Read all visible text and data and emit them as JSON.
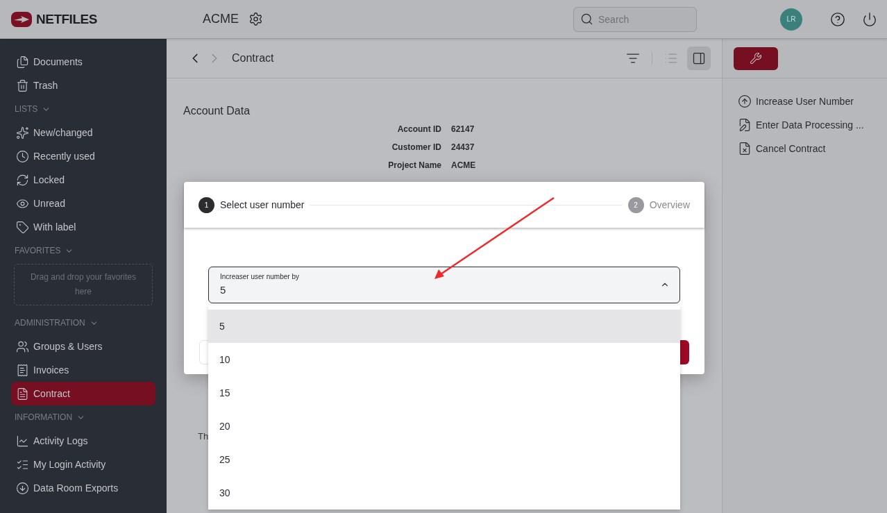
{
  "header": {
    "logo": "NETFILES",
    "project": "ACME",
    "search": {
      "placeholder": "Search"
    },
    "avatar": "LR"
  },
  "sidebar": {
    "sections": [
      {
        "items": [
          {
            "label": "Documents",
            "selected": false
          },
          {
            "label": "Trash",
            "selected": false
          }
        ]
      },
      {
        "title": "LISTS",
        "expanded": true,
        "items": [
          {
            "label": "New/changed",
            "selected": false
          },
          {
            "label": "Recently used",
            "selected": false
          },
          {
            "label": "Locked",
            "selected": false
          },
          {
            "label": "Unread",
            "selected": false
          },
          {
            "label": "With label",
            "selected": false
          }
        ]
      },
      {
        "title": "FAVORITES",
        "expanded": true,
        "dropzone": "Drag and drop your favorites here"
      },
      {
        "title": "ADMINISTRATION",
        "expanded": true,
        "items": [
          {
            "label": "Groups & Users",
            "selected": false
          },
          {
            "label": "Invoices",
            "selected": false
          },
          {
            "label": "Contract",
            "selected": true
          }
        ]
      },
      {
        "title": "INFORMATION",
        "expanded": true,
        "items": [
          {
            "label": "Activity Logs",
            "selected": false
          },
          {
            "label": "My Login Activity",
            "selected": false
          },
          {
            "label": "Data Room Exports",
            "selected": false
          }
        ]
      }
    ]
  },
  "toolbar": {
    "breadcrumb": "Contract",
    "views": [
      {
        "selected": false
      },
      {
        "selected": true
      }
    ]
  },
  "account_data": {
    "title": "Account Data",
    "fields": [
      {
        "label": "Account ID",
        "value": "62147"
      },
      {
        "label": "Customer ID",
        "value": "24437"
      },
      {
        "label": "Project Name",
        "value": "ACME"
      }
    ],
    "footer_text": "Th"
  },
  "actions": [
    "Increase User Number",
    "Enter Data Processing ...",
    "Cancel Contract"
  ],
  "dialog": {
    "steps": [
      {
        "number": "1",
        "label": "Select user number",
        "selected": true
      },
      {
        "number": "2",
        "label": "Overview",
        "selected": false
      }
    ],
    "select": {
      "label": "Increaser user number by",
      "value": "5",
      "expanded": true,
      "options": [
        {
          "label": "5",
          "selected": true
        },
        {
          "label": "10",
          "selected": false
        },
        {
          "label": "15",
          "selected": false
        },
        {
          "label": "20",
          "selected": false
        },
        {
          "label": "25",
          "selected": false
        },
        {
          "label": "30",
          "selected": false
        }
      ]
    }
  }
}
